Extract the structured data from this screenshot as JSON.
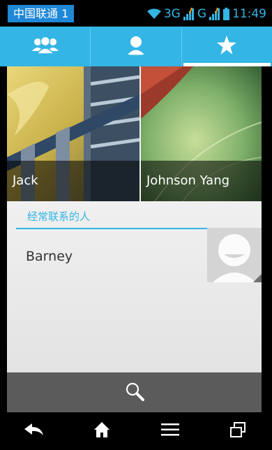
{
  "status_bar": {
    "carrier": "中国联通 1",
    "network_3g": "3G",
    "network_g": "G",
    "time": "11:49"
  },
  "tabs": [
    {
      "icon": "groups-icon",
      "active": false
    },
    {
      "icon": "person-icon",
      "active": false
    },
    {
      "icon": "star-icon",
      "active": true
    }
  ],
  "favorites": [
    {
      "name": "Jack"
    },
    {
      "name": "Johnson Yang"
    }
  ],
  "frequent": {
    "title": "经常联系的人",
    "contacts": [
      {
        "name": "Barney"
      }
    ]
  },
  "search": {
    "icon": "search-icon"
  },
  "nav": [
    {
      "icon": "back-icon"
    },
    {
      "icon": "home-icon"
    },
    {
      "icon": "menu-icon"
    },
    {
      "icon": "recent-apps-icon"
    }
  ],
  "colors": {
    "accent": "#33b5e5",
    "carrier_badge": "#1e88d6",
    "search_bar": "#5b5b5b"
  }
}
